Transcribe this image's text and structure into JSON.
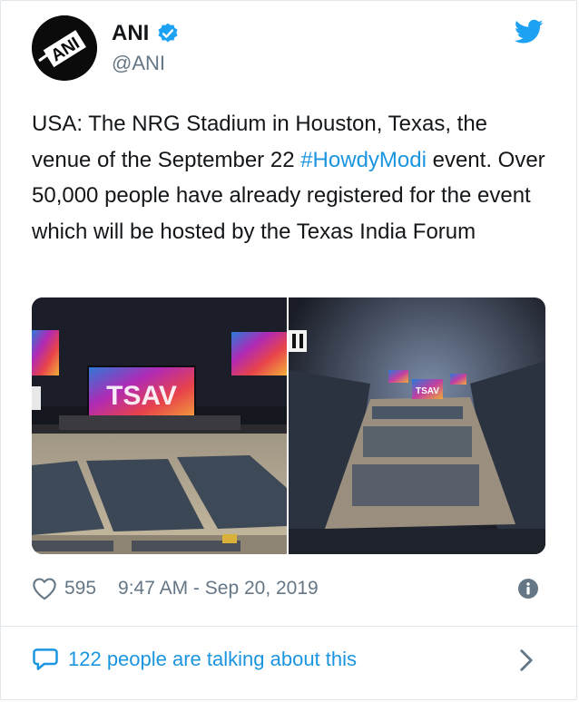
{
  "author": {
    "name": "ANI",
    "handle": "@ANI",
    "avatar_text": "ANI",
    "verified": true
  },
  "tweet": {
    "text_before": "USA: The NRG Stadium in Houston, Texas, the venue of the September 22 ",
    "hashtag": "#HowdyModi",
    "text_after": " event. Over 50,000 people have already registered for the event which will be hosted by the Texas India Forum"
  },
  "media": {
    "photo1_screen_text": "TSAV",
    "photo2_screen_text": "TSAV"
  },
  "meta": {
    "likes": "595",
    "timestamp": "9:47 AM - Sep 20, 2019"
  },
  "footer": {
    "talking": "122 people are talking about this"
  },
  "colors": {
    "link": "#1b95e0",
    "muted": "#657786",
    "text": "#14171a",
    "border": "#e1e8ed"
  },
  "icons": [
    "verified-badge-icon",
    "twitter-bird-icon",
    "heart-icon",
    "info-icon",
    "speech-bubble-icon",
    "chevron-right-icon"
  ]
}
